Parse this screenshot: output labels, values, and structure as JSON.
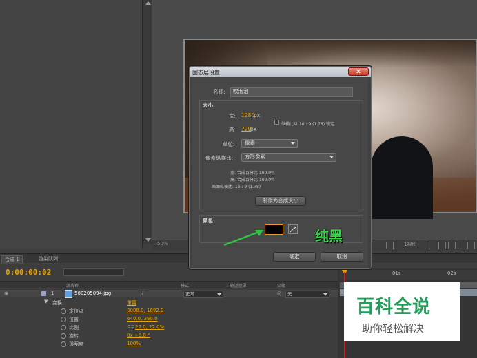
{
  "viewer": {
    "zoom": "50%",
    "view": "1视图"
  },
  "tabs": {
    "comp": "合成 1",
    "render": "渲染队列"
  },
  "timeline": {
    "timecode": "0:00:00:02",
    "columns": {
      "layer_name": "源名称",
      "mode": "模式",
      "trkmat": "T  轨道遮罩",
      "parent": "父级"
    },
    "ruler": {
      "t1": "01s",
      "t2": "02s"
    },
    "layer": {
      "index": "1",
      "name": "500205094.jpg",
      "mode": "正常",
      "parent": "无"
    },
    "transform": {
      "label": "变换",
      "reset": "重置"
    },
    "properties": [
      {
        "label": "定位点",
        "value": "3008.0, 1692.0"
      },
      {
        "label": "位置",
        "value": "640.0, 360.0"
      },
      {
        "label": "比例",
        "value": "22.0, 22.0%"
      },
      {
        "label": "旋转",
        "value": "0x +0.0 °"
      },
      {
        "label": "透明度",
        "value": "100%"
      }
    ]
  },
  "dialog": {
    "title": "固态层设置",
    "close": "x",
    "name_label": "名称:",
    "name_value": "吹泡泡",
    "size_group": "大小",
    "width_label": "宽:",
    "width_value": "1280",
    "height_label": "高:",
    "height_value": "720",
    "px": "px",
    "lock_ratio": "纵横比以 16 : 9 (1.78) 锁定",
    "units_label": "单位:",
    "units_value": "像素",
    "pixel_aspect_label": "像素纵横比:",
    "pixel_aspect_value": "方形像素",
    "info_width": "宽: 合成百分比 100.0%",
    "info_height": "高: 合成百分比 100.0%",
    "info_frame": "画面纵横比: 16 : 9 (1.78)",
    "make_comp_size": "制作为合成大小",
    "color_group": "颜色",
    "ok": "确定",
    "cancel": "取消"
  },
  "annotation": {
    "text": "纯黑",
    "color": "#37d34a"
  },
  "watermark": {
    "title": "百科全说",
    "subtitle": "助你轻松解决"
  },
  "colors": {
    "accent": "#e9a400",
    "solid_color": "#000000"
  }
}
